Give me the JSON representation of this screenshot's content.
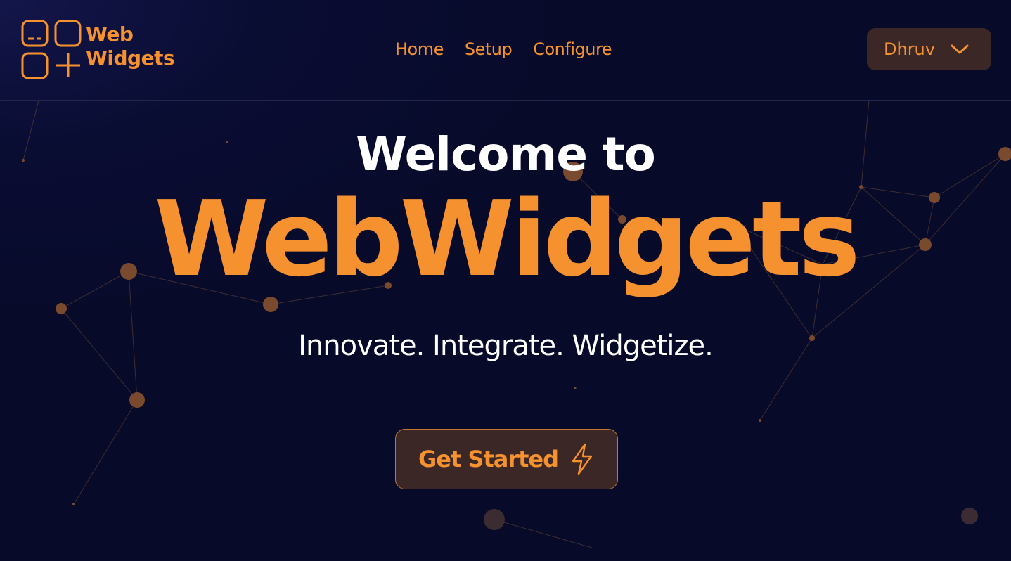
{
  "logo": {
    "line1": "Web",
    "line2": "Widgets",
    "icon": "widgets-grid-icon"
  },
  "nav": {
    "items": [
      "Home",
      "Setup",
      "Configure"
    ]
  },
  "user_menu": {
    "name": "Dhruv",
    "icon": "chevron-down-icon"
  },
  "hero": {
    "welcome": "Welcome to",
    "brand": "WebWidgets",
    "tagline": "Innovate. Integrate. Widgetize."
  },
  "cta": {
    "label": "Get Started",
    "icon": "lightning-bolt-icon"
  },
  "colors": {
    "accent": "#f5922f",
    "background": "#070a26",
    "button_bg": "#3a2726",
    "text": "#ffffff"
  }
}
